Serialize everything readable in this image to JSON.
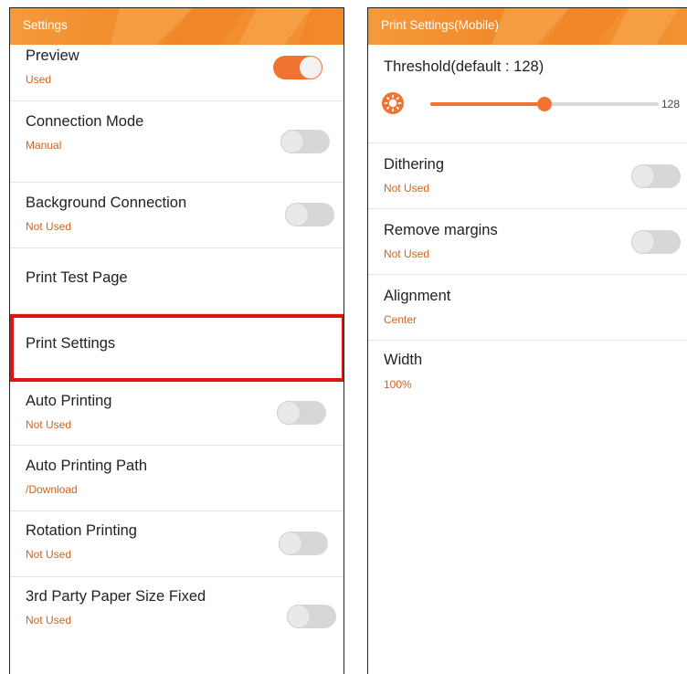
{
  "left_panel": {
    "title": "Settings",
    "items": [
      {
        "label": "Preview",
        "sub": "Used"
      },
      {
        "label": "Connection Mode",
        "sub": "Manual"
      },
      {
        "label": "Background Connection",
        "sub": "Not Used"
      },
      {
        "label": "Print Test Page"
      },
      {
        "label": "Print Settings"
      },
      {
        "label": "Auto Printing",
        "sub": "Not Used"
      },
      {
        "label": "Auto Printing Path",
        "sub": "/Download"
      },
      {
        "label": "Rotation Printing",
        "sub": "Not Used"
      },
      {
        "label": "3rd Party Paper Size Fixed",
        "sub": "Not Used"
      }
    ]
  },
  "right_panel": {
    "title": "Print Settings(Mobile)",
    "threshold": {
      "label": "Threshold(default : 128)",
      "value": "128",
      "fraction": 0.5
    },
    "items": [
      {
        "label": "Dithering",
        "sub": "Not Used"
      },
      {
        "label": "Remove margins",
        "sub": "Not Used"
      },
      {
        "label": "Alignment",
        "sub": "Center"
      },
      {
        "label": "Width",
        "sub": "100%"
      }
    ]
  },
  "colors": {
    "accent": "#f07330",
    "sub_text": "#d4621c",
    "highlight": "#e51212"
  }
}
